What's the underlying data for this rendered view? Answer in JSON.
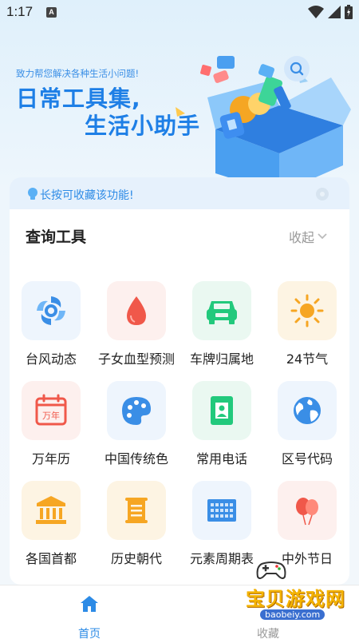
{
  "status_bar": {
    "time": "1:17",
    "notif_badge": "A"
  },
  "hero": {
    "subtitle": "致力帮您解决各种生活小问题!",
    "title_line1": "日常工具集,",
    "title_line2": "生活小助手"
  },
  "tip": {
    "text": "长按可收藏该功能!"
  },
  "section": {
    "title": "查询工具",
    "collapse_label": "收起"
  },
  "tools": [
    {
      "label": "台风动态",
      "icon": "typhoon-icon",
      "bg": "#eef5fd"
    },
    {
      "label": "子女血型预测",
      "icon": "blood-drop-icon",
      "bg": "#fdf0ee"
    },
    {
      "label": "车牌归属地",
      "icon": "car-icon",
      "bg": "#eaf8f1"
    },
    {
      "label": "24节气",
      "icon": "sun-icon",
      "bg": "#fdf4e3"
    },
    {
      "label": "万年历",
      "icon": "calendar-icon",
      "bg": "#fdf0ee"
    },
    {
      "label": "中国传统色",
      "icon": "palette-icon",
      "bg": "#eef5fd"
    },
    {
      "label": "常用电话",
      "icon": "contact-icon",
      "bg": "#eaf8f1"
    },
    {
      "label": "区号代码",
      "icon": "globe-icon",
      "bg": "#eef5fd"
    },
    {
      "label": "各国首都",
      "icon": "capital-building-icon",
      "bg": "#fdf4e3"
    },
    {
      "label": "历史朝代",
      "icon": "scroll-icon",
      "bg": "#fdf4e3"
    },
    {
      "label": "元素周期表",
      "icon": "periodic-table-icon",
      "bg": "#eef5fd"
    },
    {
      "label": "中外节日",
      "icon": "balloons-icon",
      "bg": "#fdf0ee"
    }
  ],
  "calendar_icon_text": "万年",
  "bottom_nav": {
    "home_label": "首页",
    "fav_label": "收藏"
  },
  "watermark": {
    "text": "宝贝游戏网",
    "url": "baobeiy.com"
  },
  "colors": {
    "accent": "#2d8be6",
    "title_blue": "#1e7fe6"
  }
}
